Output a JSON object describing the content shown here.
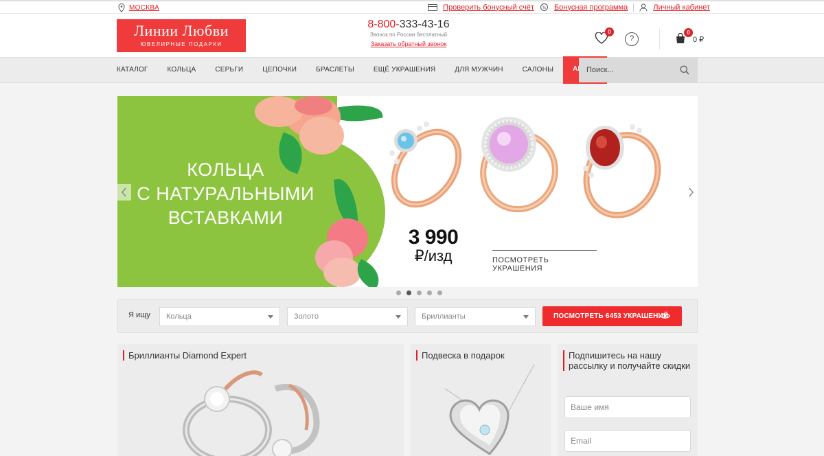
{
  "topbar": {
    "city": "МОСКВА",
    "links": {
      "bonus_check": "Проверить бонусный счёт",
      "bonus_program": "Бонусная программа",
      "account": "Личный кабинет"
    }
  },
  "header": {
    "logo": {
      "title": "Линии Любви",
      "subtitle": "ЮВЕЛИРНЫЕ ПОДАРКИ"
    },
    "phone": {
      "prefix": "8-800-",
      "number": "333-43-16",
      "note": "Звонок по России бесплатный",
      "callback": "Заказать обратный звонок"
    },
    "wishlist_count": "0",
    "help": "?",
    "cart_count": "0",
    "cart_sum": "0 ₽"
  },
  "nav": {
    "items": [
      "КАТАЛОГ",
      "КОЛЬЦА",
      "СЕРЬГИ",
      "ЦЕПОЧКИ",
      "БРАСЛЕТЫ",
      "ЕЩЁ УКРАШЕНИЯ",
      "ДЛЯ МУЖЧИН",
      "САЛОНЫ"
    ],
    "promo": "АКЦИИ",
    "search_placeholder": "Поиск..."
  },
  "banner": {
    "headline": [
      "КОЛЬЦА",
      "С НАТУРАЛЬНЫМИ",
      "ВСТАВКАМИ"
    ],
    "price": "3 990",
    "unit": "₽/изд",
    "link": "ПОСМОТРЕТЬ УКРАШЕНИЯ",
    "slides": 5,
    "active_slide": 2
  },
  "filter": {
    "label": "Я ищу",
    "type": "Кольца",
    "metal": "Золото",
    "stone": "Бриллианты",
    "button": "ПОСМОТРЕТЬ 6453 УКРАШЕНИЙ"
  },
  "cards": {
    "diamond": "Бриллианты Diamond Expert",
    "pendant": "Подвеска в подарок",
    "subscribe": [
      "Подпишитесь на нашу",
      "рассылку и получайте скидки"
    ]
  },
  "subscribe_form": {
    "name_placeholder": "Ваше имя",
    "email_placeholder": "Email"
  },
  "colors": {
    "brand_red": "#ef3b3b",
    "banner_green": "#8cc43f",
    "link_red": "#e21f26"
  }
}
